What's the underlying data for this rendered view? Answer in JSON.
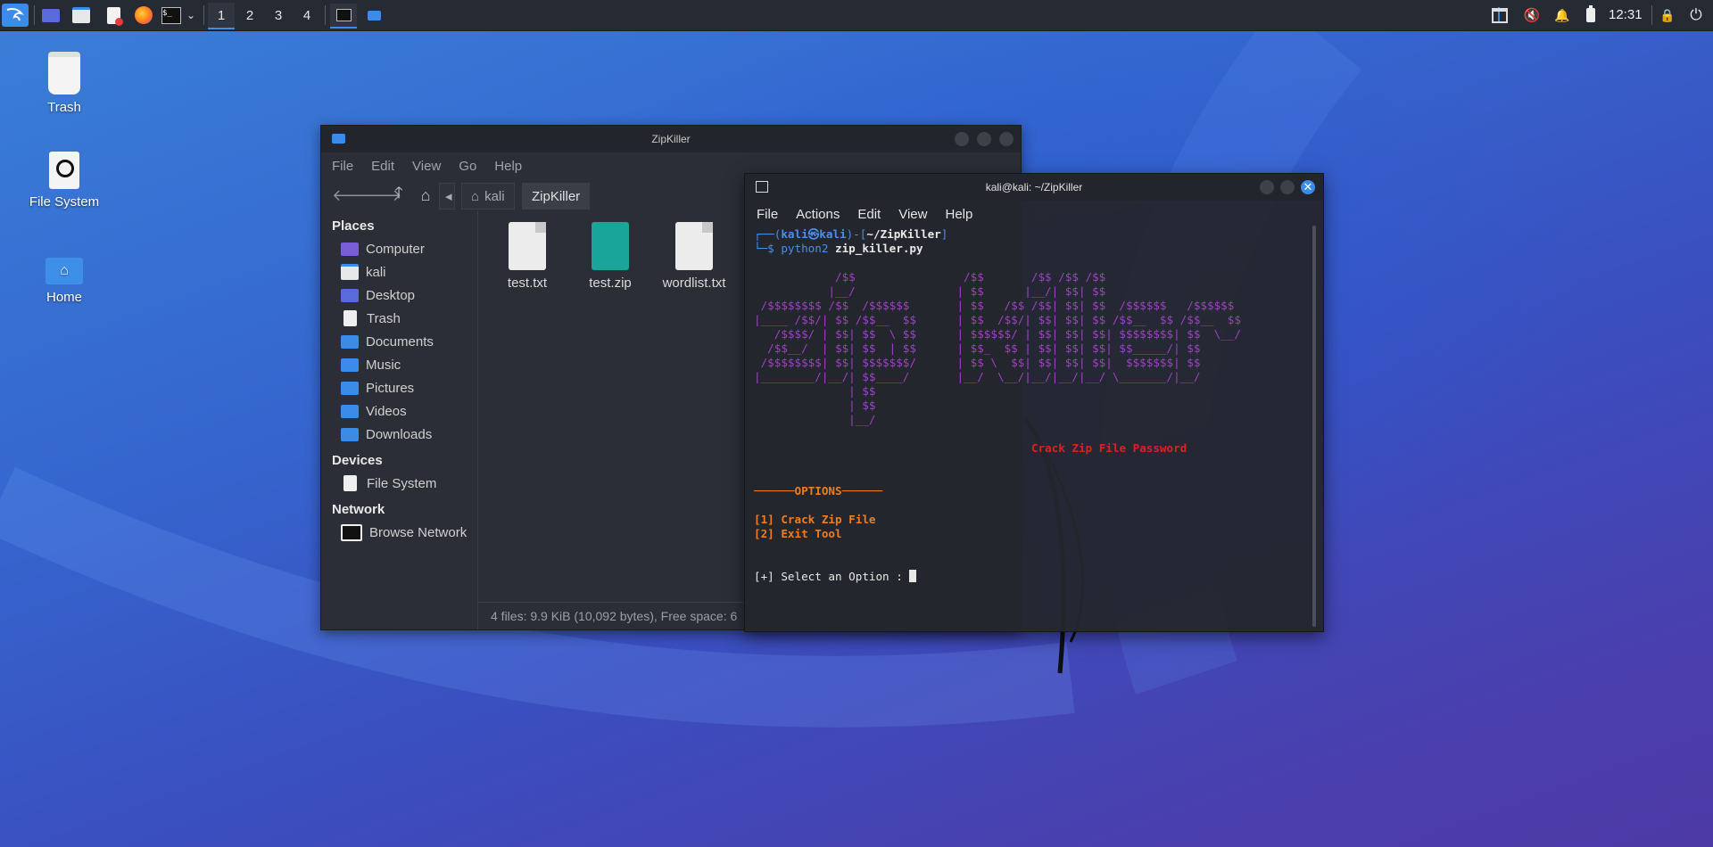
{
  "taskbar": {
    "workspaces": [
      "1",
      "2",
      "3",
      "4"
    ],
    "clock": "12:31"
  },
  "desktop": {
    "icons": [
      {
        "label": "Trash",
        "icon": "trash-icon"
      },
      {
        "label": "File System",
        "icon": "drive-icon"
      },
      {
        "label": "Home",
        "icon": "home-folder-icon"
      }
    ]
  },
  "file_manager": {
    "title": "ZipKiller",
    "menu": [
      "File",
      "Edit",
      "View",
      "Go",
      "Help"
    ],
    "breadcrumb": [
      "kali",
      "ZipKiller"
    ],
    "sidebar": {
      "places_header": "Places",
      "places": [
        "Computer",
        "kali",
        "Desktop",
        "Trash",
        "Documents",
        "Music",
        "Pictures",
        "Videos",
        "Downloads"
      ],
      "devices_header": "Devices",
      "devices": [
        "File System"
      ],
      "network_header": "Network",
      "network": [
        "Browse Network"
      ]
    },
    "files": [
      {
        "name": "test.txt",
        "type": "text"
      },
      {
        "name": "test.zip",
        "type": "zip"
      },
      {
        "name": "wordlist.txt",
        "type": "text"
      }
    ],
    "status": "4 files: 9.9 KiB (10,092 bytes), Free space: 6"
  },
  "terminal": {
    "title": "kali@kali: ~/ZipKiller",
    "menu": [
      "File",
      "Actions",
      "Edit",
      "View",
      "Help"
    ],
    "prompt_user": "kali㉿kali",
    "prompt_dir": "~/ZipKiller",
    "command_name": "python2",
    "command_arg": "zip_killer.py",
    "ascii_banner": "            /$$                /$$       /$$ /$$ /$$\n           |__/               | $$      |__/| $$| $$\n /$$$$$$$$ /$$  /$$$$$$       | $$   /$$ /$$| $$| $$  /$$$$$$   /$$$$$$\n|____ /$$/| $$ /$$__  $$      | $$  /$$/| $$| $$| $$ /$$__  $$ /$$__  $$\n   /$$$$/ | $$| $$  \\ $$      | $$$$$$/ | $$| $$| $$| $$$$$$$$| $$  \\__/\n  /$$__/  | $$| $$  | $$      | $$_  $$ | $$| $$| $$| $$_____/| $$\n /$$$$$$$$| $$| $$$$$$$/      | $$ \\  $$| $$| $$| $$|  $$$$$$$| $$\n|________/|__/| $$____/       |__/  \\__/|__/|__/|__/ \\_______/|__/\n              | $$\n              | $$\n              |__/",
    "subtitle": "Crack Zip File Password",
    "options_header": "──────OPTIONS──────",
    "options": [
      "[1] Crack Zip File",
      "[2] Exit Tool"
    ],
    "select_prompt": "[+] Select an Option : "
  }
}
